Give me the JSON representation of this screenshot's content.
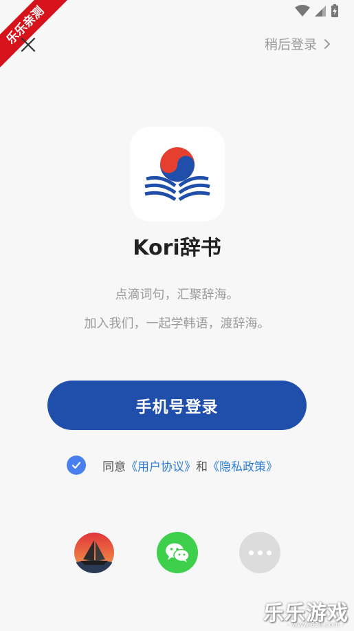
{
  "watermark": {
    "ribbon": "乐乐亲测",
    "corner_text": "乐乐游戏",
    "corner_url": "- www.61ll.com -"
  },
  "header": {
    "skip_label": "稍后登录"
  },
  "app": {
    "name": "Kori辞书",
    "slogan_line1": "点滴词句，汇聚辞海。",
    "slogan_line2": "加入我们，一起学韩语，渡辞海。"
  },
  "login": {
    "phone_button_label": "手机号登录"
  },
  "agreement": {
    "checked": true,
    "prefix": "同意",
    "user_agreement": "《用户协议》",
    "and": "和",
    "privacy_policy": "《隐私政策》"
  },
  "social_icons": [
    "app-sailboat-icon",
    "wechat-icon",
    "more-icon"
  ],
  "colors": {
    "primary_button": "#1f4faa",
    "link": "#2f7cd3",
    "checkbox": "#4a80ee",
    "wechat": "#3ecf4c",
    "ribbon": "#d6121b"
  }
}
